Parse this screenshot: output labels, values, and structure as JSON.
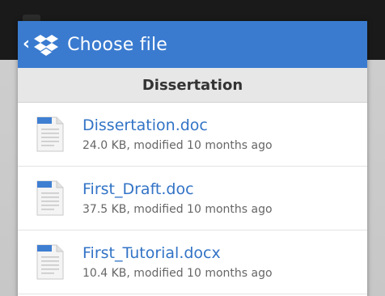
{
  "header": {
    "back_glyph": "‹",
    "title": "Choose file",
    "logo_icon": "dropbox-icon",
    "bg_color": "#3a7bd0"
  },
  "folder": {
    "title": "Dissertation"
  },
  "files": [
    {
      "name": "Dissertation.doc",
      "meta": "24.0 KB, modified 10 months ago",
      "icon": "word-doc-icon"
    },
    {
      "name": "First_Draft.doc",
      "meta": "37.5 KB, modified 10 months ago",
      "icon": "word-doc-icon"
    },
    {
      "name": "First_Tutorial.docx",
      "meta": "10.4 KB, modified 10 months ago",
      "icon": "word-doc-icon"
    }
  ],
  "colors": {
    "link": "#3273c6",
    "meta": "#666666",
    "folder_bar": "#e7e7e7"
  }
}
